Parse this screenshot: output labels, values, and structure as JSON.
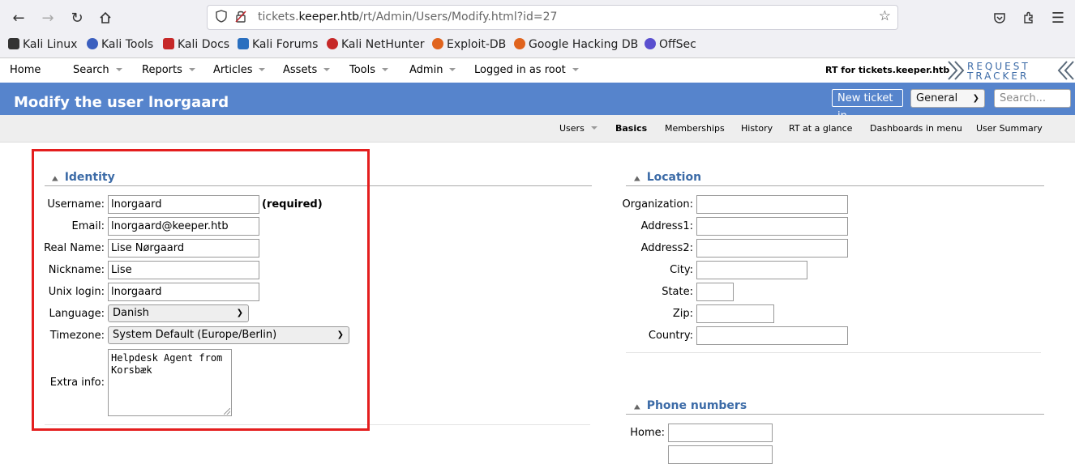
{
  "browser": {
    "url_prefix": "tickets.",
    "url_domain": "keeper.htb",
    "url_path": "/rt/Admin/Users/Modify.html?id=27",
    "bookmarks": [
      {
        "label": "Kali Linux",
        "icon": "kali-linux-icon",
        "color": "#333333"
      },
      {
        "label": "Kali Tools",
        "icon": "kali-tools-icon",
        "color": "#3b5fbf"
      },
      {
        "label": "Kali Docs",
        "icon": "kali-docs-icon",
        "color": "#c62828"
      },
      {
        "label": "Kali Forums",
        "icon": "kali-forums-icon",
        "color": "#2a6fbf"
      },
      {
        "label": "Kali NetHunter",
        "icon": "kali-nethunter-icon",
        "color": "#c62828"
      },
      {
        "label": "Exploit-DB",
        "icon": "exploit-db-icon",
        "color": "#e0641e"
      },
      {
        "label": "Google Hacking DB",
        "icon": "google-hacking-db-icon",
        "color": "#e0641e"
      },
      {
        "label": "OffSec",
        "icon": "offsec-icon",
        "color": "#5a4fcf"
      }
    ]
  },
  "nav": {
    "items": [
      "Home",
      "Search",
      "Reports",
      "Articles",
      "Assets",
      "Tools",
      "Admin",
      "Logged in as root"
    ],
    "rt_for": "RT for tickets.keeper.htb",
    "logo_line1": "REQUEST",
    "logo_line2": "TRACKER"
  },
  "header": {
    "title": "Modify the user lnorgaard",
    "new_ticket": "New ticket in",
    "queue": "General",
    "search_placeholder": "Search..."
  },
  "subnav": {
    "items": [
      "Users",
      "Basics",
      "Memberships",
      "History",
      "RT at a glance",
      "Dashboards in menu",
      "User Summary"
    ],
    "active": "Basics"
  },
  "identity": {
    "title": "Identity",
    "username_label": "Username:",
    "username": "lnorgaard",
    "required": "(required)",
    "email_label": "Email:",
    "email": "lnorgaard@keeper.htb",
    "realname_label": "Real Name:",
    "realname": "Lise Nørgaard",
    "nickname_label": "Nickname:",
    "nickname": "Lise",
    "unixlogin_label": "Unix login:",
    "unixlogin": "lnorgaard",
    "language_label": "Language:",
    "language": "Danish",
    "timezone_label": "Timezone:",
    "timezone": "System Default (Europe/Berlin)",
    "extrainfo_label": "Extra info:",
    "extrainfo": "Helpdesk Agent from\nKorsbæk"
  },
  "location": {
    "title": "Location",
    "organization_label": "Organization:",
    "address1_label": "Address1:",
    "address2_label": "Address2:",
    "city_label": "City:",
    "state_label": "State:",
    "zip_label": "Zip:",
    "country_label": "Country:"
  },
  "phones": {
    "title": "Phone numbers",
    "home_label": "Home:"
  },
  "colors": {
    "header_blue": "#5684cc",
    "section_blue": "#3c6ba7",
    "highlight_red": "#e41e1e"
  }
}
